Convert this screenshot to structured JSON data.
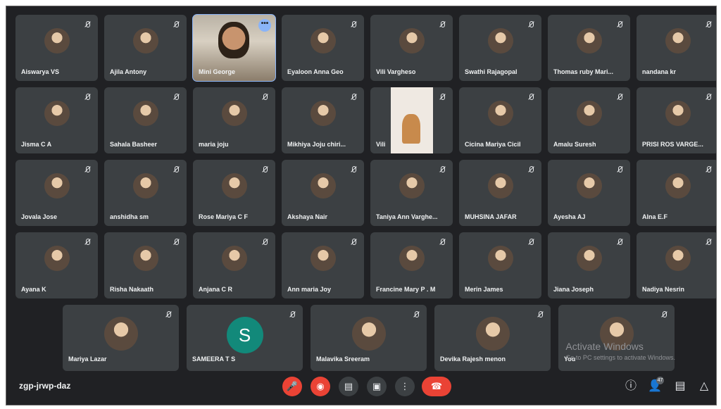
{
  "rows": [
    [
      "Aiswarya VS",
      "Ajila Antony",
      "Mini George",
      "Eyaloon Anna Geo",
      "Vili Vargheso",
      "Swathi Rajagopal",
      "Thomas ruby Mari...",
      "nandana kr"
    ],
    [
      "Jisma C A",
      "Sahala Basheer",
      "maria joju",
      "Mikhiya Joju chiri...",
      "Vili",
      "Cicina Mariya Cicil",
      "Amalu Suresh",
      "PRISI ROS VARGE..."
    ],
    [
      "Jovala Jose",
      "anshidha sm",
      "Rose Mariya C F",
      "Akshaya Nair",
      "Taniya Ann Varghe...",
      "MUHSINA JAFAR",
      "Ayesha AJ",
      "Alna E.F"
    ],
    [
      "Ayana K",
      "Risha Nakaath",
      "Anjana C R",
      "Ann maria Joy",
      "Francine Mary P . M",
      "Merin James",
      "Jiana Joseph",
      "Nadiya Nesrin"
    ]
  ],
  "last_row": [
    "Mariya Lazar",
    "SAMEERA T S",
    "Malavika Sreeram",
    "Devika Rajesh menon",
    "You"
  ],
  "active_tile_name": "Mini George",
  "avatar_letter": "S",
  "more_options": "•••",
  "watermark_title": "Activate Windows",
  "watermark_sub": "Go to PC settings to activate Windows.",
  "meeting_code": "zgp-jrwp-daz",
  "controls": {
    "mic": "🎤",
    "camera": "◉",
    "captions": "▤",
    "present": "▣",
    "more": "⋮",
    "hang_up": "☎"
  },
  "right_controls": {
    "info": "ⓘ",
    "people": "👤",
    "people_count": "47",
    "chat": "▤",
    "activities": "△"
  }
}
